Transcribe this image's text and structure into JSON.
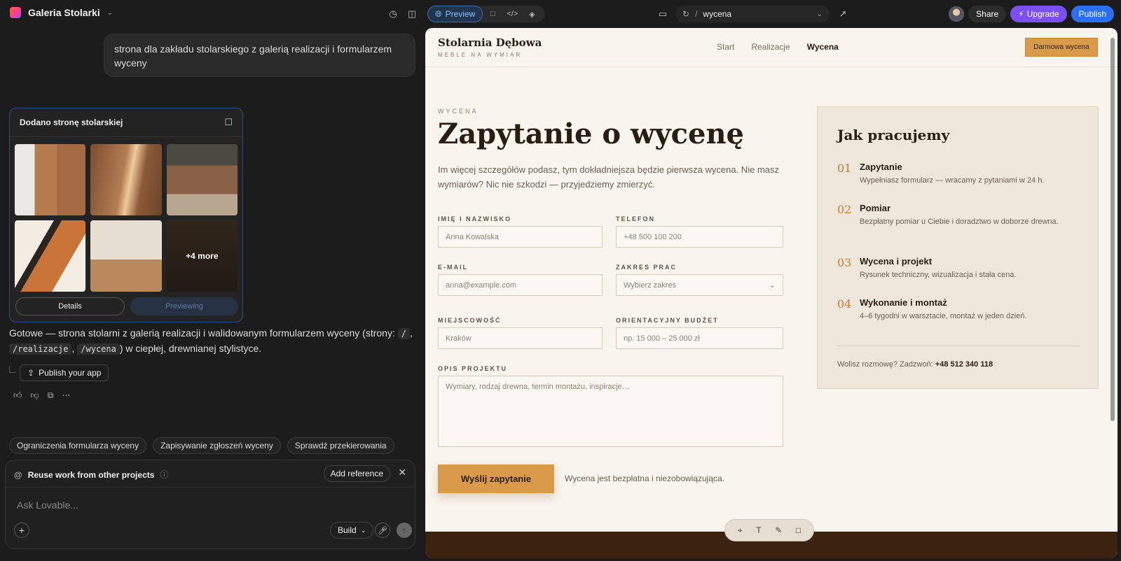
{
  "topbar": {
    "project_name": "Galeria Stolarki",
    "preview_label": "Preview",
    "url_prefix": "/",
    "url_path": "wycena",
    "share_label": "Share",
    "upgrade_label": "Upgrade",
    "publish_label": "Publish"
  },
  "chat": {
    "prompt": "strona dla zakładu stolarskiego z galerią realizacji i formularzem wyceny",
    "card_title": "Dodano stronę stolarskiej",
    "more_label": "+4 more",
    "details_label": "Details",
    "previewing_label": "Previewing",
    "reply_before": "Gotowe — strona stolarni z galerią realizacji i walidowanym formularzem wyceny (strony: ",
    "route_root": "/",
    "comma": ",",
    "route_realizacje": "/realizacje",
    "route_wycena": "/wycena",
    "reply_after": ") w ciepłej, drewnianej stylistyce.",
    "publish_app_label": "Publish your app",
    "chips": [
      "Ograniczenia formularza wyceny",
      "Zapisywanie zgłoszeń wyceny",
      "Sprawdź przekierowania"
    ],
    "reuse_label": "Reuse work from other projects",
    "add_reference_label": "Add reference",
    "ask_placeholder": "Ask Lovable...",
    "build_label": "Build"
  },
  "site": {
    "logo": "Stolarnia Dębowa",
    "logo_sub": "MEBLE NA WYMIAR",
    "nav": [
      "Start",
      "Realizacje",
      "Wycena"
    ],
    "cta": "Darmowa wycena",
    "eyebrow": "WYCENA",
    "title": "Zapytanie o wycenę",
    "lead": "Im więcej szczegółów podasz, tym dokładniejsza będzie pierwsza wycena. Nie masz wymiarów? Nic nie szkodzi — przyjedziemy zmierzyć.",
    "form": {
      "name_label": "IMIĘ I NAZWISKO",
      "name_placeholder": "Anna Kowalska",
      "phone_label": "TELEFON",
      "phone_placeholder": "+48 500 100 200",
      "email_label": "E-MAIL",
      "email_placeholder": "anna@example.com",
      "scope_label": "ZAKRES PRAC",
      "scope_value": "Wybierz zakres",
      "city_label": "MIEJSCOWOŚĆ",
      "city_placeholder": "Kraków",
      "budget_label": "ORIENTACYJNY BUDŻET",
      "budget_placeholder": "np. 15 000 – 25 000 zł",
      "desc_label": "OPIS PROJEKTU",
      "desc_placeholder": "Wymiary, rodzaj drewna, termin montażu, inspiracje…",
      "submit": "Wyślij zapytanie",
      "note": "Wycena jest bezpłatna i niezobowiązująca."
    },
    "process": {
      "title": "Jak pracujemy",
      "steps": [
        {
          "num": "01",
          "title": "Zapytanie",
          "desc": "Wypełniasz formularz — wracamy z pytaniami w 24 h."
        },
        {
          "num": "02",
          "title": "Pomiar",
          "desc": "Bezpłatny pomiar u Ciebie i doradztwo w doborze drewna."
        },
        {
          "num": "03",
          "title": "Wycena i projekt",
          "desc": "Rysunek techniczny, wizualizacja i stała cena."
        },
        {
          "num": "04",
          "title": "Wykonanie i montaż",
          "desc": "4–6 tygodni w warsztacie, montaż w jeden dzień."
        }
      ],
      "call_text": "Wolisz rozmowę? Zadzwoń: ",
      "phone": "+48 512 340 118"
    }
  }
}
